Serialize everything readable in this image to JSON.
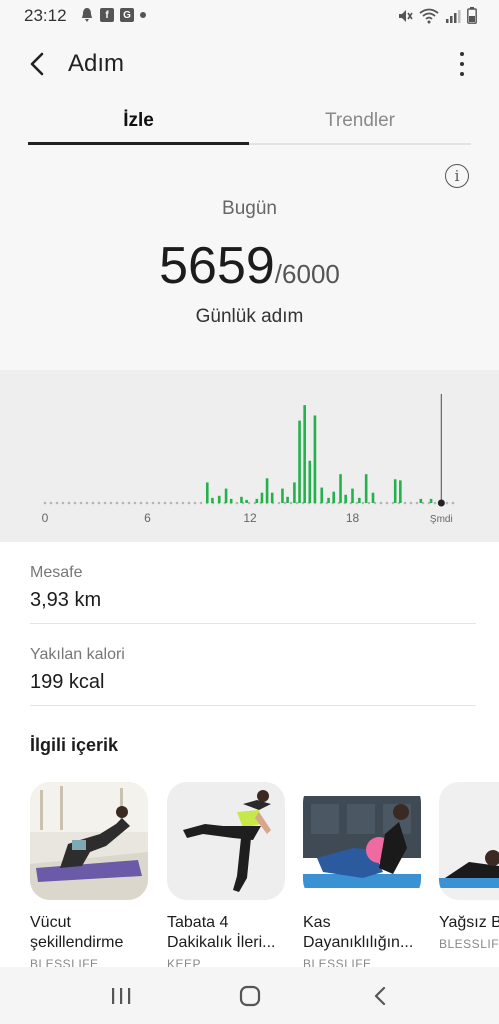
{
  "status_bar": {
    "time": "23:12",
    "left_icons": [
      "notification-icon",
      "facebook-icon",
      "g-icon",
      "dot-icon"
    ],
    "right_icons": [
      "mute-icon",
      "wifi-icon",
      "signal-icon",
      "battery-icon"
    ]
  },
  "header": {
    "title": "Adım",
    "back_icon": "chevron-left-icon",
    "more_icon": "more-vertical-icon"
  },
  "tabs": [
    {
      "label": "İzle",
      "active": true
    },
    {
      "label": "Trendler",
      "active": false
    }
  ],
  "summary": {
    "info_icon_glyph": "i",
    "period": "Bugün",
    "steps": "5659",
    "goal": "/6000",
    "caption": "Günlük adım"
  },
  "chart_data": {
    "type": "bar",
    "x_ticks": [
      "0",
      "6",
      "12",
      "18",
      "Şmdi"
    ],
    "xlim": [
      0,
      24
    ],
    "ylim": [
      0,
      100
    ],
    "now_hour": 23.2,
    "bar_color": "#22b24c",
    "bars": [
      {
        "x": 9.5,
        "y": 20
      },
      {
        "x": 9.8,
        "y": 5
      },
      {
        "x": 10.2,
        "y": 7
      },
      {
        "x": 10.6,
        "y": 14
      },
      {
        "x": 10.9,
        "y": 4
      },
      {
        "x": 11.5,
        "y": 6
      },
      {
        "x": 11.8,
        "y": 3
      },
      {
        "x": 12.4,
        "y": 4
      },
      {
        "x": 12.7,
        "y": 10
      },
      {
        "x": 13.0,
        "y": 24
      },
      {
        "x": 13.3,
        "y": 10
      },
      {
        "x": 13.9,
        "y": 14
      },
      {
        "x": 14.2,
        "y": 6
      },
      {
        "x": 14.6,
        "y": 20
      },
      {
        "x": 14.9,
        "y": 80
      },
      {
        "x": 15.2,
        "y": 95
      },
      {
        "x": 15.5,
        "y": 41
      },
      {
        "x": 15.8,
        "y": 85
      },
      {
        "x": 16.2,
        "y": 15
      },
      {
        "x": 16.6,
        "y": 5
      },
      {
        "x": 16.9,
        "y": 11
      },
      {
        "x": 17.3,
        "y": 28
      },
      {
        "x": 17.6,
        "y": 8
      },
      {
        "x": 18.0,
        "y": 14
      },
      {
        "x": 18.4,
        "y": 5
      },
      {
        "x": 18.8,
        "y": 28
      },
      {
        "x": 19.2,
        "y": 10
      },
      {
        "x": 20.5,
        "y": 23
      },
      {
        "x": 20.8,
        "y": 22
      },
      {
        "x": 22.0,
        "y": 4
      },
      {
        "x": 22.6,
        "y": 4
      }
    ]
  },
  "stats": [
    {
      "label": "Mesafe",
      "value": "3,93 km"
    },
    {
      "label": "Yakılan kalori",
      "value": "199 kcal"
    }
  ],
  "related": {
    "title": "İlgili içerik",
    "cards": [
      {
        "title": "Vücut şekillendirme",
        "source": "BLESSLIFE"
      },
      {
        "title": "Tabata 4 Dakikalık İleri...",
        "source": "KEEP"
      },
      {
        "title": "Kas Dayanıklılığın...",
        "source": "BLESSLIFE"
      },
      {
        "title": "Yağsız B Vücuda",
        "source": "BLESSLIFE"
      }
    ]
  },
  "navbar": {
    "icons": [
      "recents-icon",
      "home-icon",
      "back-nav-icon"
    ]
  }
}
